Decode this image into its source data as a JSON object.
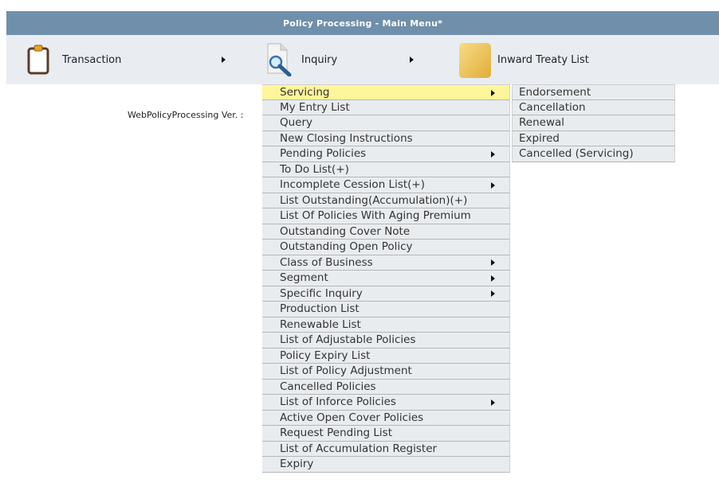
{
  "window": {
    "title": "Policy Processing - Main Menu*"
  },
  "menubar": {
    "items": [
      {
        "label": "Transaction",
        "icon": "clipboard-icon",
        "has_submenu": true
      },
      {
        "label": "Inquiry",
        "icon": "magnifier-document-icon",
        "has_submenu": true
      },
      {
        "label": "Inward Treaty List",
        "icon": "folder-icon",
        "has_submenu": false
      }
    ]
  },
  "version_label": "WebPolicyProcessing Ver. :",
  "inquiry_menu": {
    "items": [
      {
        "label": "Servicing",
        "submenu": true,
        "highlighted": true
      },
      {
        "label": "My Entry List",
        "submenu": false
      },
      {
        "label": "Query",
        "submenu": false
      },
      {
        "label": "New Closing Instructions",
        "submenu": false
      },
      {
        "label": "Pending Policies",
        "submenu": true
      },
      {
        "label": "To Do List(+)",
        "submenu": false
      },
      {
        "label": "Incomplete Cession List(+)",
        "submenu": true
      },
      {
        "label": "List Outstanding(Accumulation)(+)",
        "submenu": false
      },
      {
        "label": "List Of Policies With Aging Premium",
        "submenu": false
      },
      {
        "label": "Outstanding Cover Note",
        "submenu": false
      },
      {
        "label": "Outstanding Open Policy",
        "submenu": false
      },
      {
        "label": "Class of Business",
        "submenu": true
      },
      {
        "label": "Segment",
        "submenu": true
      },
      {
        "label": "Specific Inquiry",
        "submenu": true
      },
      {
        "label": "Production List",
        "submenu": false
      },
      {
        "label": "Renewable List",
        "submenu": false
      },
      {
        "label": "List of Adjustable Policies",
        "submenu": false
      },
      {
        "label": "Policy Expiry List",
        "submenu": false
      },
      {
        "label": "List of Policy Adjustment",
        "submenu": false
      },
      {
        "label": "Cancelled Policies",
        "submenu": false
      },
      {
        "label": "List of Inforce Policies",
        "submenu": true
      },
      {
        "label": "Active Open Cover Policies",
        "submenu": false
      },
      {
        "label": "Request Pending List",
        "submenu": false
      },
      {
        "label": "List of Accumulation Register",
        "submenu": false
      },
      {
        "label": "Expiry",
        "submenu": false
      }
    ]
  },
  "servicing_menu": {
    "items": [
      {
        "label": "Endorsement"
      },
      {
        "label": "Cancellation"
      },
      {
        "label": "Renewal"
      },
      {
        "label": "Expired"
      },
      {
        "label": "Cancelled (Servicing)"
      }
    ]
  },
  "colors": {
    "titlebar_bg": "#6f8fab",
    "menubar_bg": "#e9edf2",
    "menu_item_bg": "#e9ecef",
    "highlight_bg": "#fff59a"
  }
}
